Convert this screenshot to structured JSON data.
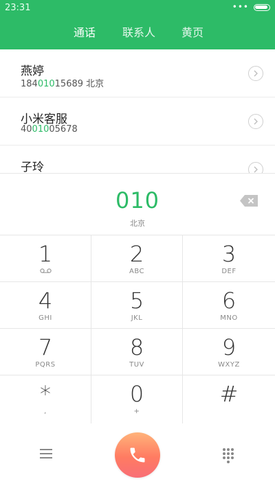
{
  "status": {
    "time": "23:31",
    "dots": "•••"
  },
  "tabs": [
    {
      "label": "通话",
      "active": true
    },
    {
      "label": "联系人",
      "active": false
    },
    {
      "label": "黄页",
      "active": false
    }
  ],
  "contacts": [
    {
      "name": "燕婷",
      "num_pre": "184",
      "num_match": "010",
      "num_post": "15689",
      "location": "北京"
    },
    {
      "name": "小米客服",
      "num_pre": "40",
      "num_match": "010",
      "num_post": "05678",
      "location": ""
    },
    {
      "name": "子玲",
      "num_pre": "",
      "num_match": "",
      "num_post": "",
      "location": ""
    }
  ],
  "dialer": {
    "number": "010",
    "location": "北京"
  },
  "keys": [
    {
      "digit": "1",
      "letters": ""
    },
    {
      "digit": "2",
      "letters": "ABC"
    },
    {
      "digit": "3",
      "letters": "DEF"
    },
    {
      "digit": "4",
      "letters": "GHI"
    },
    {
      "digit": "5",
      "letters": "JKL"
    },
    {
      "digit": "6",
      "letters": "MNO"
    },
    {
      "digit": "7",
      "letters": "PQRS"
    },
    {
      "digit": "8",
      "letters": "TUV"
    },
    {
      "digit": "9",
      "letters": "WXYZ"
    },
    {
      "digit": "*",
      "letters": ","
    },
    {
      "digit": "0",
      "letters": "+"
    },
    {
      "digit": "#",
      "letters": ""
    }
  ],
  "icons": {
    "voicemail": "voicemail-icon",
    "backspace": "backspace-icon",
    "call": "phone-icon",
    "menu": "menu-icon",
    "keypad": "keypad-icon",
    "chevron": "chevron-right-icon"
  },
  "colors": {
    "accent": "#2dbb67",
    "call_top": "#ffb37a",
    "call_bottom": "#f86e76"
  }
}
